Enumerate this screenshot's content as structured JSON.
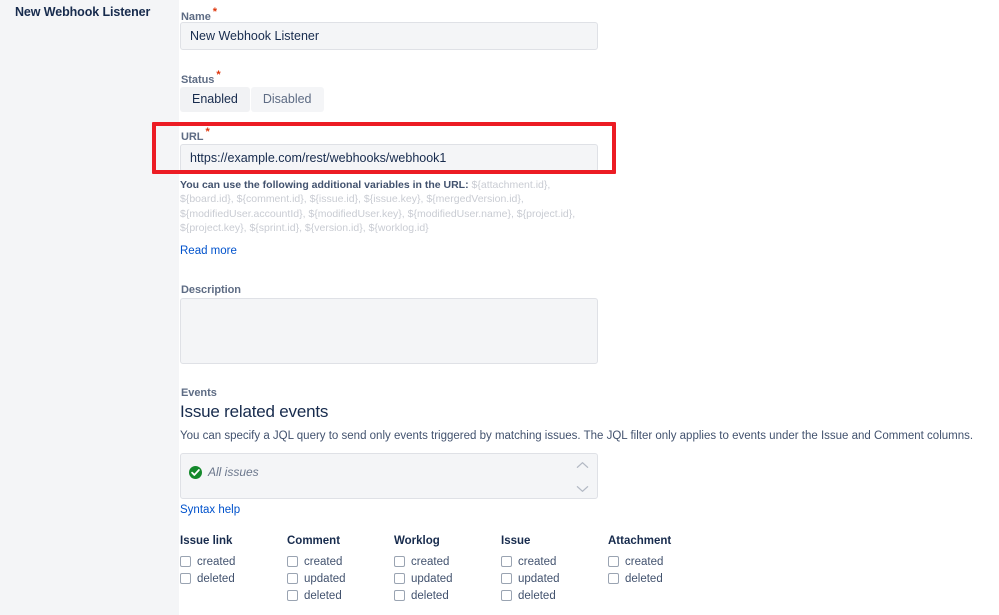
{
  "panel": {
    "title": "New Webhook Listener"
  },
  "form": {
    "name": {
      "label": "Name",
      "required_marker": "*",
      "value": "New Webhook Listener"
    },
    "status": {
      "label": "Status",
      "required_marker": "*",
      "options": [
        "Enabled",
        "Disabled"
      ],
      "selected": "Enabled"
    },
    "url": {
      "label": "URL",
      "required_marker": "*",
      "value": "https://example.com/rest/webhooks/webhook1",
      "highlight_color": "#ec1c24"
    },
    "variables_help": {
      "lead": "You can use the following additional variables in the URL:",
      "variables": " ${attachment.id}, ${board.id}, ${comment.id}, ${issue.id}, ${issue.key}, ${mergedVersion.id}, ${modifiedUser.accountId}, ${modifiedUser.key}, ${modifiedUser.name}, ${project.id}, ${project.key}, ${sprint.id}, ${version.id}, ${worklog.id}",
      "read_more_label": "Read more"
    },
    "description": {
      "label": "Description",
      "value": "",
      "placeholder": ""
    }
  },
  "events": {
    "label": "Events",
    "heading": "Issue related events",
    "description": "You can specify a JQL query to send only events triggered by matching issues. The JQL filter only applies to events under the Issue and Comment columns.",
    "jql": {
      "value": "All issues",
      "status_icon": "check-circle-icon",
      "status_color": "#14892c"
    },
    "syntax_help_label": "Syntax help",
    "columns": [
      {
        "title": "Issue link",
        "items": [
          {
            "label": "created",
            "checked": false
          },
          {
            "label": "deleted",
            "checked": false
          }
        ]
      },
      {
        "title": "Comment",
        "items": [
          {
            "label": "created",
            "checked": false
          },
          {
            "label": "updated",
            "checked": false
          },
          {
            "label": "deleted",
            "checked": false
          }
        ]
      },
      {
        "title": "Worklog",
        "items": [
          {
            "label": "created",
            "checked": false
          },
          {
            "label": "updated",
            "checked": false
          },
          {
            "label": "deleted",
            "checked": false
          }
        ]
      },
      {
        "title": "Issue",
        "items": [
          {
            "label": "created",
            "checked": false
          },
          {
            "label": "updated",
            "checked": false
          },
          {
            "label": "deleted",
            "checked": false
          }
        ]
      },
      {
        "title": "Attachment",
        "items": [
          {
            "label": "created",
            "checked": false
          },
          {
            "label": "deleted",
            "checked": false
          }
        ]
      }
    ]
  },
  "theme": {
    "link_color": "#0052cc",
    "label_color": "#5e6c84",
    "text_color": "#42526e",
    "required_color": "#de350b",
    "panel_bg": "#f4f5f7"
  }
}
